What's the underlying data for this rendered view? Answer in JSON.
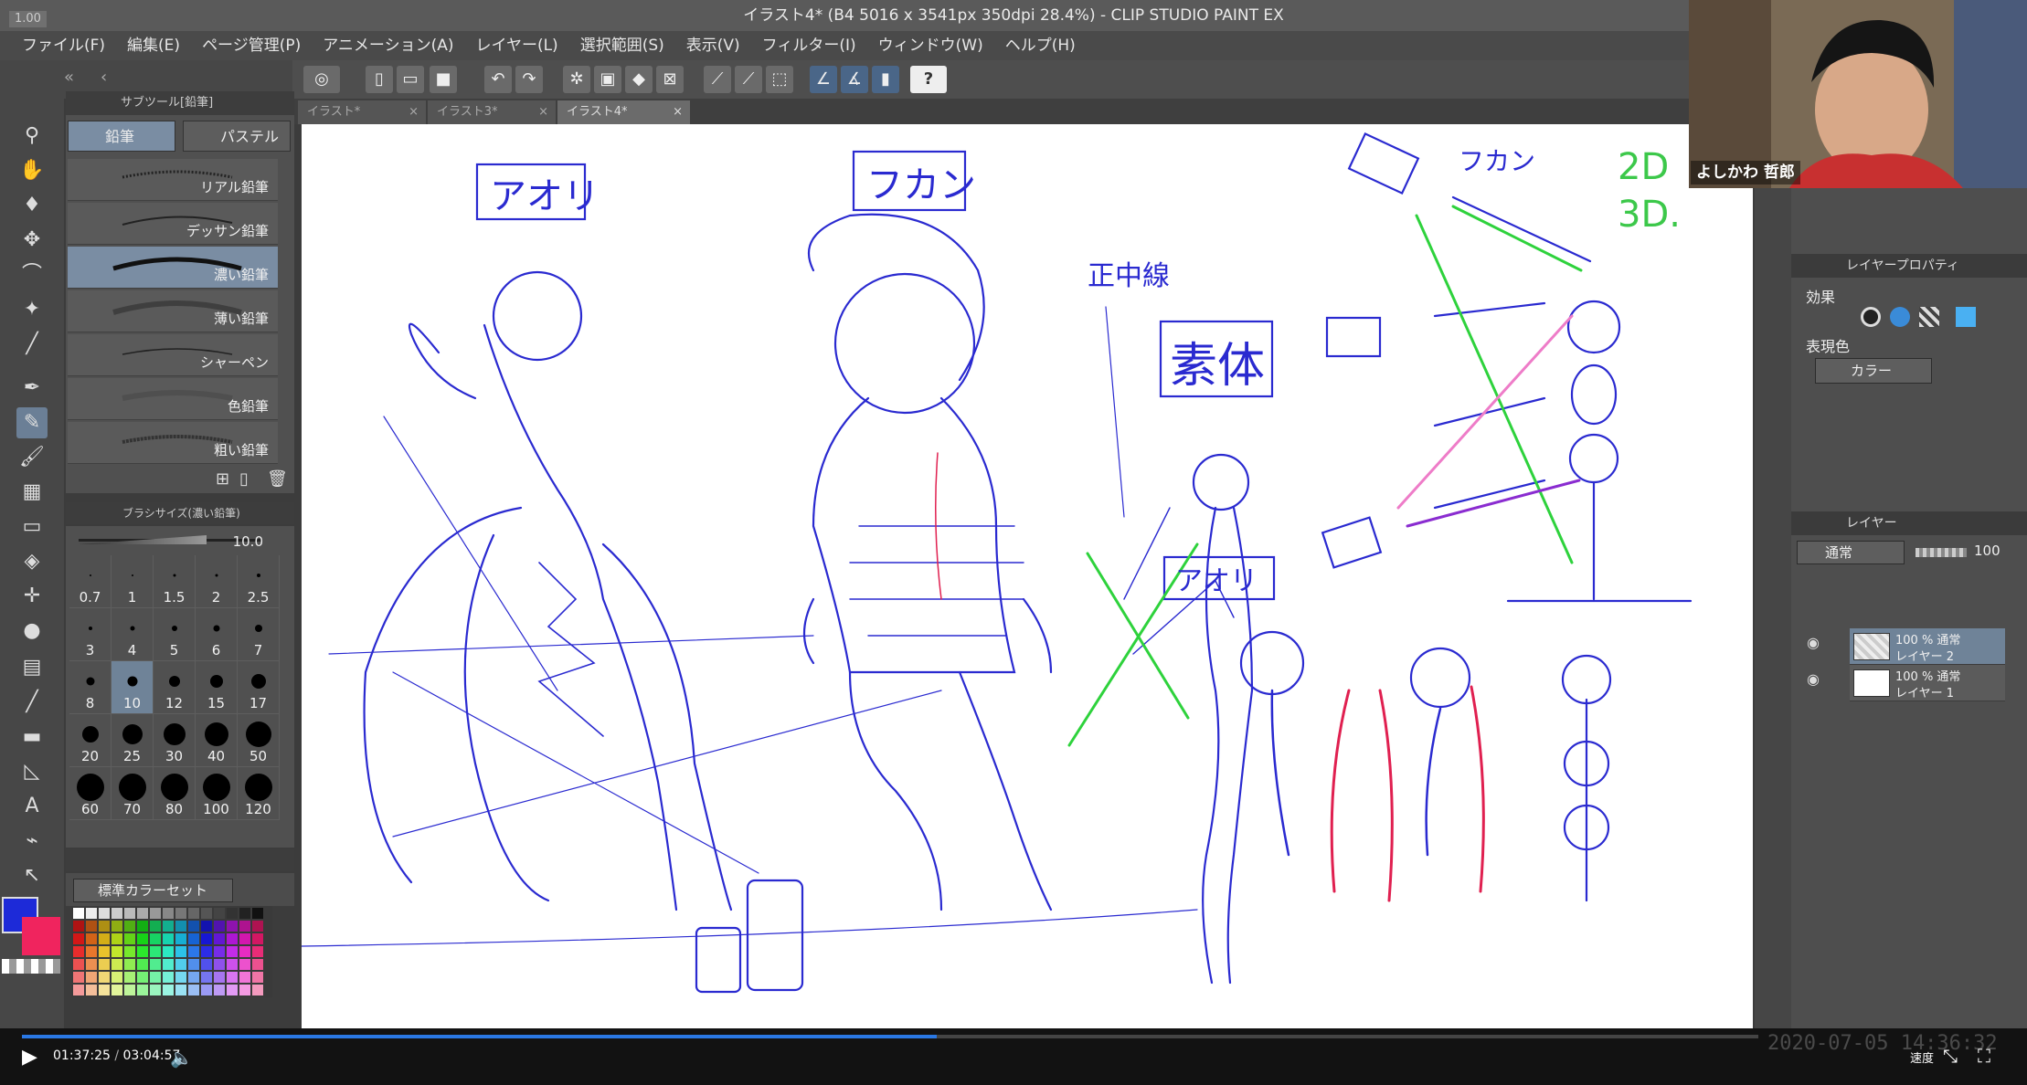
{
  "window": {
    "title": "イラスト4* (B4 5016 x 3541px 350dpi 28.4%)  - CLIP STUDIO PAINT EX",
    "zoom_tag": "1.00"
  },
  "menu": [
    "ファイル(F)",
    "編集(E)",
    "ページ管理(P)",
    "アニメーション(A)",
    "レイヤー(L)",
    "選択範囲(S)",
    "表示(V)",
    "フィルター(I)",
    "ウィンドウ(W)",
    "ヘルプ(H)"
  ],
  "tabs": [
    {
      "label": "イラスト*"
    },
    {
      "label": "イラスト3*"
    },
    {
      "label": "イラスト4*"
    }
  ],
  "subtool": {
    "header": "サブツール[鉛筆]",
    "tab_pencil": "鉛筆",
    "tab_pastel": "パステル",
    "brushes": [
      "リアル鉛筆",
      "デッサン鉛筆",
      "濃い鉛筆",
      "薄い鉛筆",
      "シャーペン",
      "色鉛筆",
      "粗い鉛筆"
    ]
  },
  "brush_size": {
    "header": "ブラシサイズ(濃い鉛筆)",
    "value": "10.0",
    "sizes": [
      "0.7",
      "1",
      "1.5",
      "2",
      "2.5",
      "3",
      "4",
      "5",
      "6",
      "7",
      "8",
      "10",
      "12",
      "15",
      "17",
      "20",
      "25",
      "30",
      "40",
      "50",
      "60",
      "70",
      "80",
      "100",
      "120"
    ],
    "selected": "10"
  },
  "color_set": {
    "name": "標準カラーセット"
  },
  "colors": {
    "main": "#1d2ad8",
    "sub": "#f0245e",
    "accent": "#6f8398"
  },
  "layer_property": {
    "header": "レイヤープロパティ",
    "effect_label": "効果",
    "expression_label": "表現色",
    "expression_value": "カラー"
  },
  "layers": {
    "header": "レイヤー",
    "blend_mode": "通常",
    "opacity": "100",
    "items": [
      {
        "line1": "100 % 通常",
        "line2": "レイヤー 2"
      },
      {
        "line1": "100 % 通常",
        "line2": "レイヤー 1"
      }
    ]
  },
  "webcam": {
    "name": "よしかわ 哲郎"
  },
  "video": {
    "current": "01:37:25",
    "separator": "/",
    "total": "03:04:57",
    "progress": 0.527,
    "speed_label": "速度",
    "date_overlay": "2020-07-05 14:36:32"
  },
  "canvas_text": {
    "aori_left": "アオリ",
    "fukan_center": "フカン",
    "seichusen": "正中線",
    "sotai": "素体",
    "fukan_right": "フカン",
    "aori_right": "アオリ",
    "label_2d": "2D",
    "label_3d": "3D."
  }
}
